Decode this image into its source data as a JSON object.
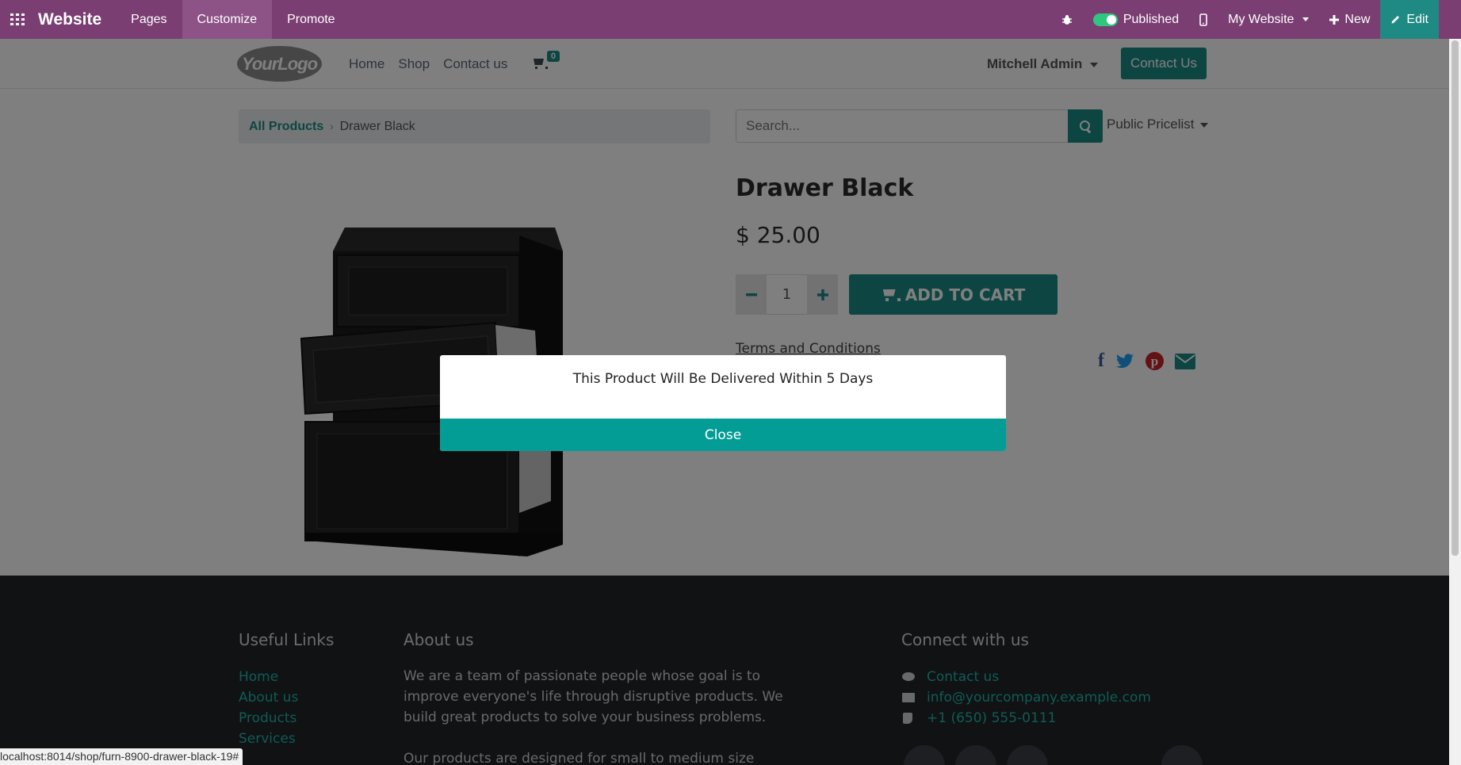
{
  "adminbar": {
    "brand": "Website",
    "menu": [
      "Pages",
      "Customize",
      "Promote"
    ],
    "published_label": "Published",
    "my_website_label": "My Website",
    "new_label": "New",
    "edit_label": "Edit",
    "accent": "#7a3e72"
  },
  "header": {
    "logo_text": "YourLogo",
    "nav": [
      "Home",
      "Shop",
      "Contact us"
    ],
    "cart_count": "0",
    "user_name": "Mitchell Admin",
    "contact_button": "Contact Us",
    "brand_color": "#1a8b84"
  },
  "breadcrumb": {
    "root": "All Products",
    "current": "Drawer Black"
  },
  "search": {
    "placeholder": "Search..."
  },
  "pricelist_label": "Public Pricelist",
  "product": {
    "name": "Drawer Black",
    "price": "$ 25.00",
    "quantity": "1",
    "add_to_cart": "ADD TO CART",
    "terms": "Terms and Conditions"
  },
  "share_icons": [
    "facebook-icon",
    "twitter-icon",
    "pinterest-icon",
    "email-icon"
  ],
  "footer": {
    "useful_links_title": "Useful Links",
    "useful_links": [
      "Home",
      "About us",
      "Products",
      "Services"
    ],
    "about_title": "About us",
    "about_p1": "We are a team of passionate people whose goal is to improve everyone's life through disruptive products. We build great products to solve your business problems.",
    "about_p2": "Our products are designed for small to medium size",
    "connect_title": "Connect with us",
    "contact_link": "Contact us",
    "email": "info@yourcompany.example.com",
    "phone": "+1 (650) 555-0111"
  },
  "modal": {
    "message": "This Product Will Be Delivered Within 5 Days",
    "close_label": "Close"
  },
  "status_url": "localhost:8014/shop/furn-8900-drawer-black-19#"
}
